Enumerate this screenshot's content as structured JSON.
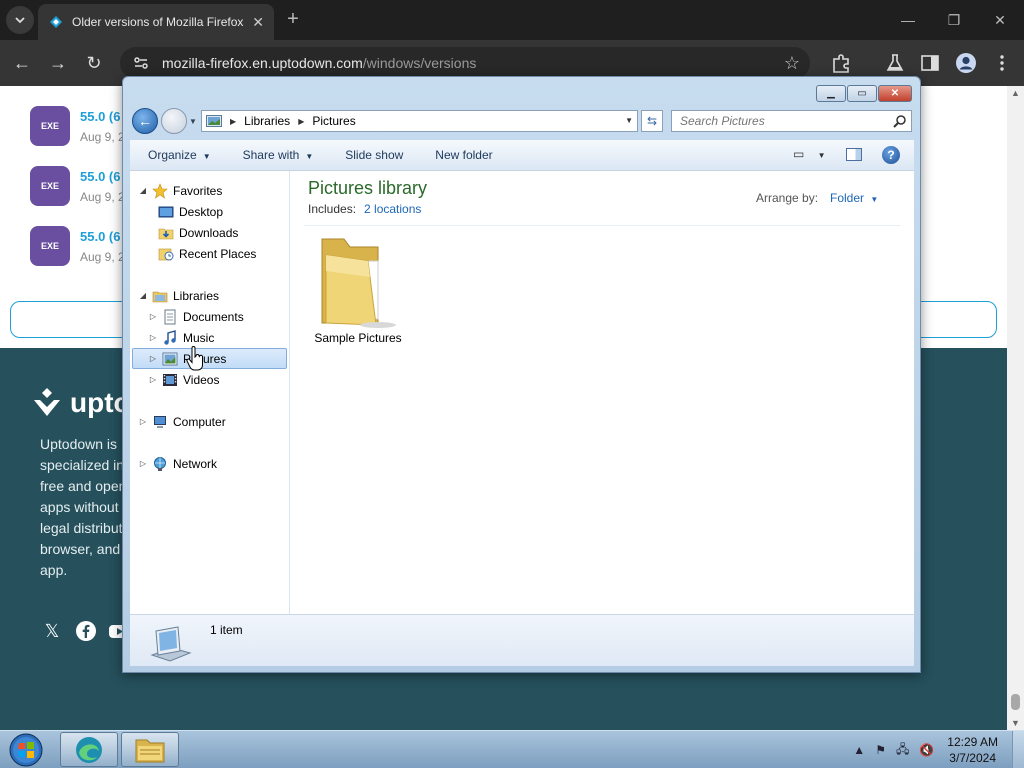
{
  "browser": {
    "tab_title": "Older versions of Mozilla Firefox",
    "url_host": "mozilla-firefox.en.uptodown.com",
    "url_path": "/windows/versions"
  },
  "page": {
    "versions": [
      {
        "badge": "EXE",
        "name": "55.0 (6",
        "date": "Aug 9, 2"
      },
      {
        "badge": "EXE",
        "name": "55.0 (6",
        "date": "Aug 9, 2"
      },
      {
        "badge": "EXE",
        "name": "55.0 (6",
        "date": "Aug 9, 2"
      }
    ],
    "footer_logo": "upto",
    "footer_desc_lines": [
      "Uptodown is",
      "specialized in",
      "free and open",
      "apps without",
      "legal distribut",
      "browser, and",
      "app."
    ]
  },
  "explorer": {
    "breadcrumb": [
      "Libraries",
      "Pictures"
    ],
    "search_placeholder": "Search Pictures",
    "commands": {
      "organize": "Organize",
      "share_with": "Share with",
      "slide_show": "Slide show",
      "new_folder": "New folder"
    },
    "nav": {
      "favorites": "Favorites",
      "desktop": "Desktop",
      "downloads": "Downloads",
      "recent_places": "Recent Places",
      "libraries": "Libraries",
      "documents": "Documents",
      "music": "Music",
      "pictures": "Pictures",
      "videos": "Videos",
      "computer": "Computer",
      "network": "Network"
    },
    "library_title": "Pictures library",
    "includes_label": "Includes:",
    "includes_link": "2 locations",
    "arrange_label": "Arrange by:",
    "arrange_value": "Folder",
    "items": [
      {
        "name": "Sample Pictures",
        "type": "folder"
      }
    ],
    "item_count": "1 item"
  },
  "taskbar": {
    "time": "12:29 AM",
    "date": "3/7/2024"
  },
  "colors": {
    "accent_link": "#1e66b8",
    "library_title": "#2a6a2a",
    "uptodown_blue": "#1e9fd8",
    "exe_badge": "#6a4fa0",
    "footer_bg": "#25505c"
  }
}
